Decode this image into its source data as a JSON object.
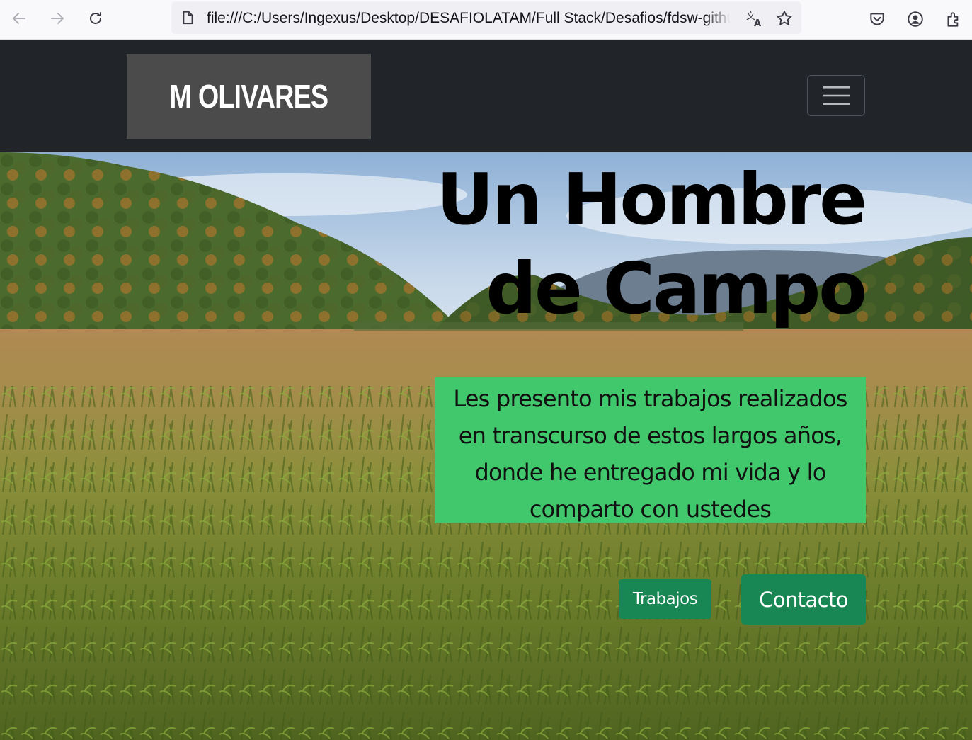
{
  "browser": {
    "url": "file:///C:/Users/Ingexus/Desktop/DESAFIOLATAM/Full Stack/Desafios/fdsw-github/",
    "icons": [
      "back-icon",
      "forward-icon",
      "reload-icon",
      "page-icon",
      "translate-icon",
      "bookmark-star-icon",
      "pocket-icon",
      "account-icon",
      "extensions-icon"
    ]
  },
  "navbar": {
    "brand": "M OLIVARES",
    "toggler_icon": "hamburger-icon",
    "background": "#212529"
  },
  "hero": {
    "title_line1": "Un Hombre",
    "title_line2": "de Campo",
    "intro": "Les presento mis trabajos realizados en transcurso de estos largos años, donde he entregado mi vida y lo comparto con ustedes",
    "intro_background": "#41c76c",
    "buttons": {
      "trabajos": "Trabajos",
      "contacto": "Contacto"
    },
    "button_color": "#198754"
  }
}
